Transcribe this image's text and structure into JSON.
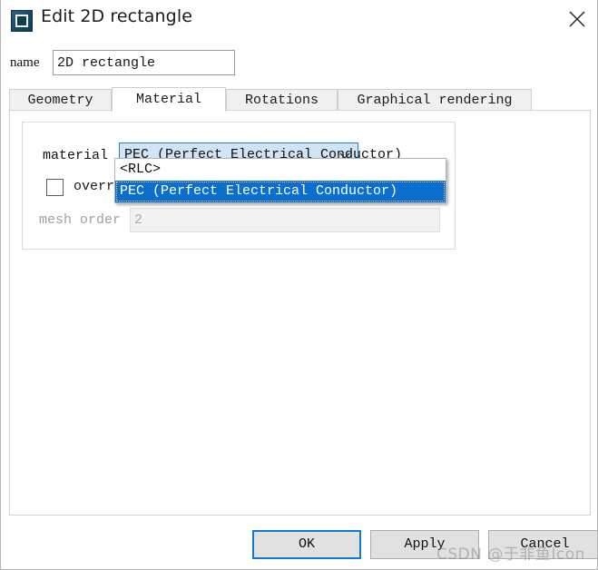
{
  "window": {
    "title": "Edit 2D rectangle",
    "icon": "rectangle-shape-icon",
    "close_label": "close-icon"
  },
  "name_field": {
    "label": "name",
    "value": "2D rectangle",
    "placeholder": "name"
  },
  "tabs": [
    {
      "label": "Geometry",
      "active": false
    },
    {
      "label": "Material",
      "active": true
    },
    {
      "label": "Rotations",
      "active": false
    },
    {
      "label": "Graphical rendering",
      "active": false
    }
  ],
  "material_panel": {
    "material_label": "material",
    "combo_value": "PEC (Perfect Electrical Conductor)",
    "combo_arrow_icon": "chevron-down-icon",
    "dropdown_open": true,
    "dropdown_options": [
      {
        "label": "<RLC>",
        "selected": false
      },
      {
        "label": "PEC (Perfect Electrical Conductor)",
        "selected": true
      }
    ],
    "override_checkbox": {
      "label": "overr",
      "checked": false
    },
    "mesh_order": {
      "label": "mesh order",
      "value": "2",
      "enabled": false
    }
  },
  "buttons": {
    "ok": "OK",
    "apply": "Apply",
    "cancel": "Cancel"
  },
  "watermark": "CSDN @于非鱼Icon",
  "colors": {
    "accent": "#0a6fce",
    "focus_border": "#0d7ad6",
    "combo_fill": "#cfe5f7",
    "title_icon": "#164963"
  }
}
